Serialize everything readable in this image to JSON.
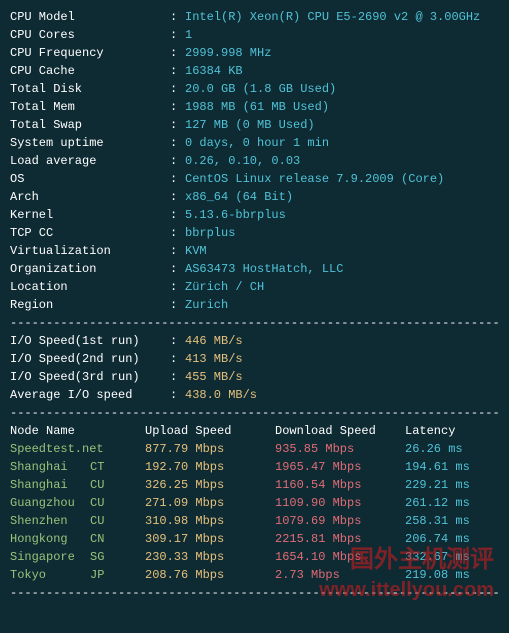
{
  "sysinfo": [
    {
      "label": "CPU Model",
      "value": "Intel(R) Xeon(R) CPU E5-2690 v2 @ 3.00GHz"
    },
    {
      "label": "CPU Cores",
      "value": "1"
    },
    {
      "label": "CPU Frequency",
      "value": "2999.998 MHz"
    },
    {
      "label": "CPU Cache",
      "value": "16384 KB"
    },
    {
      "label": "Total Disk",
      "value": "20.0 GB (1.8 GB Used)"
    },
    {
      "label": "Total Mem",
      "value": "1988 MB (61 MB Used)"
    },
    {
      "label": "Total Swap",
      "value": "127 MB (0 MB Used)"
    },
    {
      "label": "System uptime",
      "value": "0 days, 0 hour 1 min"
    },
    {
      "label": "Load average",
      "value": "0.26, 0.10, 0.03"
    },
    {
      "label": "OS",
      "value": "CentOS Linux release 7.9.2009 (Core)"
    },
    {
      "label": "Arch",
      "value": "x86_64 (64 Bit)"
    },
    {
      "label": "Kernel",
      "value": "5.13.6-bbrplus"
    },
    {
      "label": "TCP CC",
      "value": "bbrplus"
    },
    {
      "label": "Virtualization",
      "value": "KVM"
    },
    {
      "label": "Organization",
      "value": "AS63473 HostHatch, LLC"
    },
    {
      "label": "Location",
      "value": "Zürich / CH"
    },
    {
      "label": "Region",
      "value": "Zurich"
    }
  ],
  "io": [
    {
      "label": "I/O Speed(1st run)",
      "value": "446 MB/s"
    },
    {
      "label": "I/O Speed(2nd run)",
      "value": "413 MB/s"
    },
    {
      "label": "I/O Speed(3rd run)",
      "value": "455 MB/s"
    },
    {
      "label": "Average I/O speed",
      "value": "438.0 MB/s"
    }
  ],
  "speed_header": {
    "node": "Node Name",
    "upload": "Upload Speed",
    "download": "Download Speed",
    "latency": "Latency"
  },
  "speed": [
    {
      "node": "Speedtest.net",
      "provider": "",
      "upload": "877.79 Mbps",
      "download": "935.85 Mbps",
      "latency": "26.26 ms"
    },
    {
      "node": "Shanghai",
      "provider": "CT",
      "upload": "192.70 Mbps",
      "download": "1965.47 Mbps",
      "latency": "194.61 ms"
    },
    {
      "node": "Shanghai",
      "provider": "CU",
      "upload": "326.25 Mbps",
      "download": "1160.54 Mbps",
      "latency": "229.21 ms"
    },
    {
      "node": "Guangzhou",
      "provider": "CU",
      "upload": "271.09 Mbps",
      "download": "1109.90 Mbps",
      "latency": "261.12 ms"
    },
    {
      "node": "Shenzhen",
      "provider": "CU",
      "upload": "310.98 Mbps",
      "download": "1079.69 Mbps",
      "latency": "258.31 ms"
    },
    {
      "node": "Hongkong",
      "provider": "CN",
      "upload": "309.17 Mbps",
      "download": "2215.81 Mbps",
      "latency": "206.74 ms"
    },
    {
      "node": "Singapore",
      "provider": "SG",
      "upload": "230.33 Mbps",
      "download": "1654.10 Mbps",
      "latency": "332.67 ms"
    },
    {
      "node": "Tokyo",
      "provider": "JP",
      "upload": "208.76 Mbps",
      "download": "2.73 Mbps",
      "latency": "219.08 ms"
    }
  ],
  "dashes": "----------------------------------------------------------------------",
  "colon": ":",
  "watermark": {
    "line1": "国外主机测评",
    "line2": "www.ittellyou.com"
  }
}
